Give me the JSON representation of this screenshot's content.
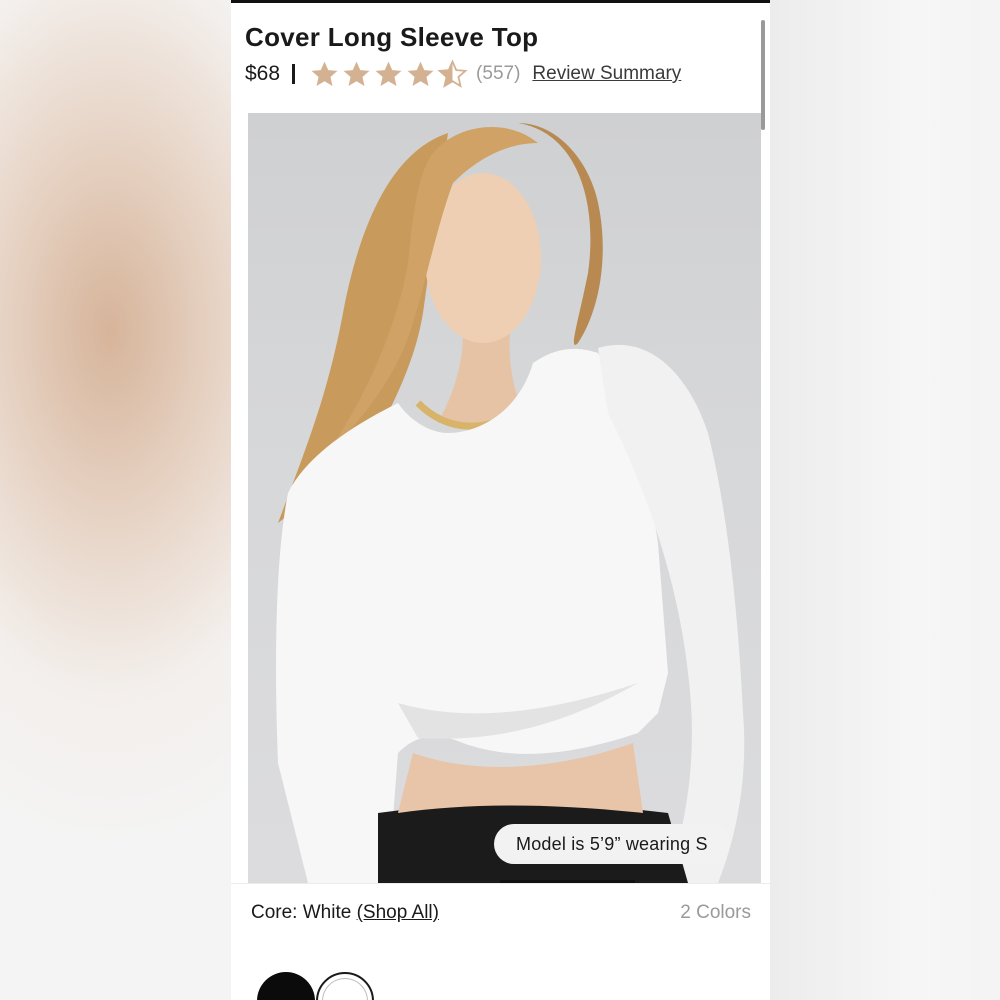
{
  "product": {
    "title": "Cover Long Sleeve Top",
    "price": "$68",
    "rating": 4.5,
    "rating_count": "(557)",
    "review_link": "Review Summary",
    "star_color": "#d4b291"
  },
  "hero": {
    "model_badge": "Model is 5’9” wearing S"
  },
  "color_selector": {
    "label_prefix": "Core: White",
    "shop_all": "(Shop All)",
    "count": "2 Colors",
    "swatches": [
      {
        "name": "Black",
        "color": "#0b0b0b",
        "selected": false
      },
      {
        "name": "White",
        "color": "#ffffff",
        "selected": true
      }
    ]
  }
}
